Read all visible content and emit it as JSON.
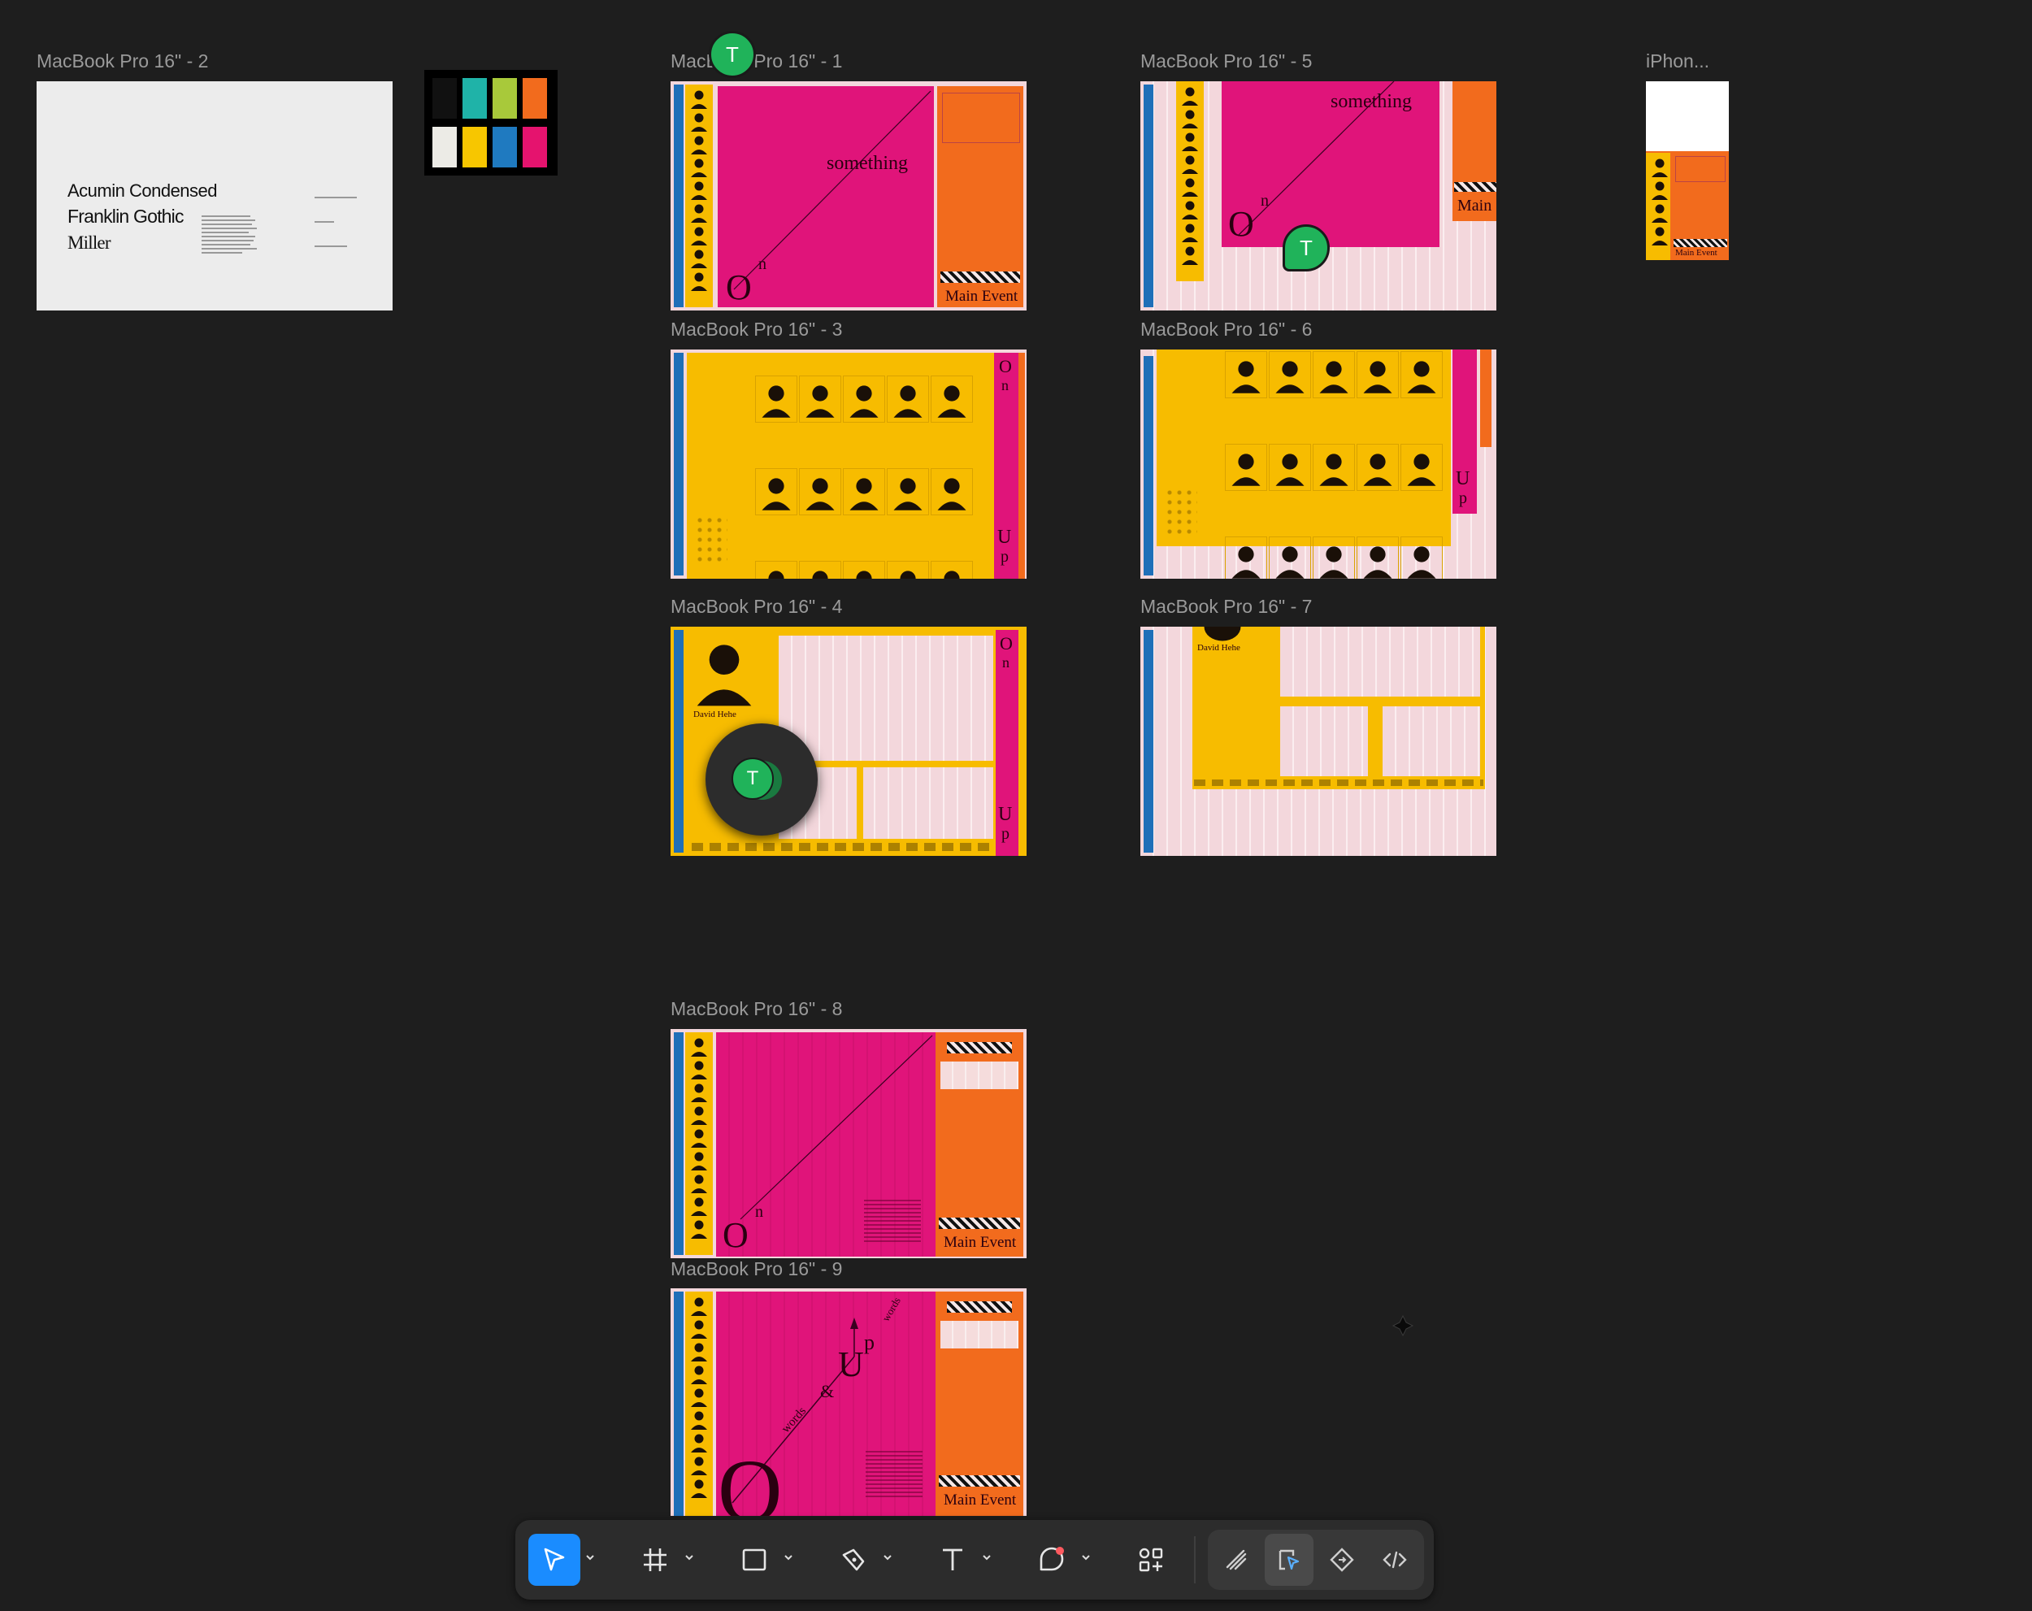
{
  "frames": {
    "f2": "MacBook Pro 16\" - 2",
    "f1": "MacBook Pro 16\" - 1",
    "f5": "MacBook Pro 16\" - 5",
    "fiphone": "iPhon...",
    "f3": "MacBook Pro 16\" - 3",
    "f6": "MacBook Pro 16\" - 6",
    "f4": "MacBook Pro 16\" - 4",
    "f7": "MacBook Pro 16\" - 7",
    "f8": "MacBook Pro 16\" - 8",
    "f9": "MacBook Pro 16\" - 9"
  },
  "typography": {
    "font1": "Acumin Condensed",
    "font2": "Franklin Gothic",
    "font3": "Miller"
  },
  "design_text": {
    "something": "something",
    "main_event": "Main Event",
    "main": "Main",
    "on_o": "O",
    "on_n": "n",
    "up_u": "U",
    "up_p": "p",
    "name": "David Hehe",
    "words": "words",
    "amp": "&"
  },
  "swatches": [
    "#111111",
    "#1fb3a8",
    "#a8c93a",
    "#f26b1d",
    "#ecebe6",
    "#f7c600",
    "#1f7ac0",
    "#e5136e"
  ],
  "colors": {
    "canvas": "#1e1e1e",
    "pink": "#e0147a",
    "orange": "#f26b1d",
    "yellow": "#f7bc00",
    "blue": "#1f6fb8",
    "grid_pink": "#f3d7dc",
    "accent": "#1a8cff",
    "collab": "#20b35a"
  },
  "collaborators": [
    "T",
    "T",
    "T"
  ],
  "toolbar": {
    "tools": [
      "move-tool",
      "frame-tool",
      "shape-tool",
      "pen-tool",
      "text-tool",
      "comment-tool",
      "actions-tool"
    ],
    "right": [
      "draw-mode",
      "design-mode",
      "prototype-mode",
      "dev-mode"
    ],
    "active": "move-tool",
    "active_right": "design-mode"
  }
}
